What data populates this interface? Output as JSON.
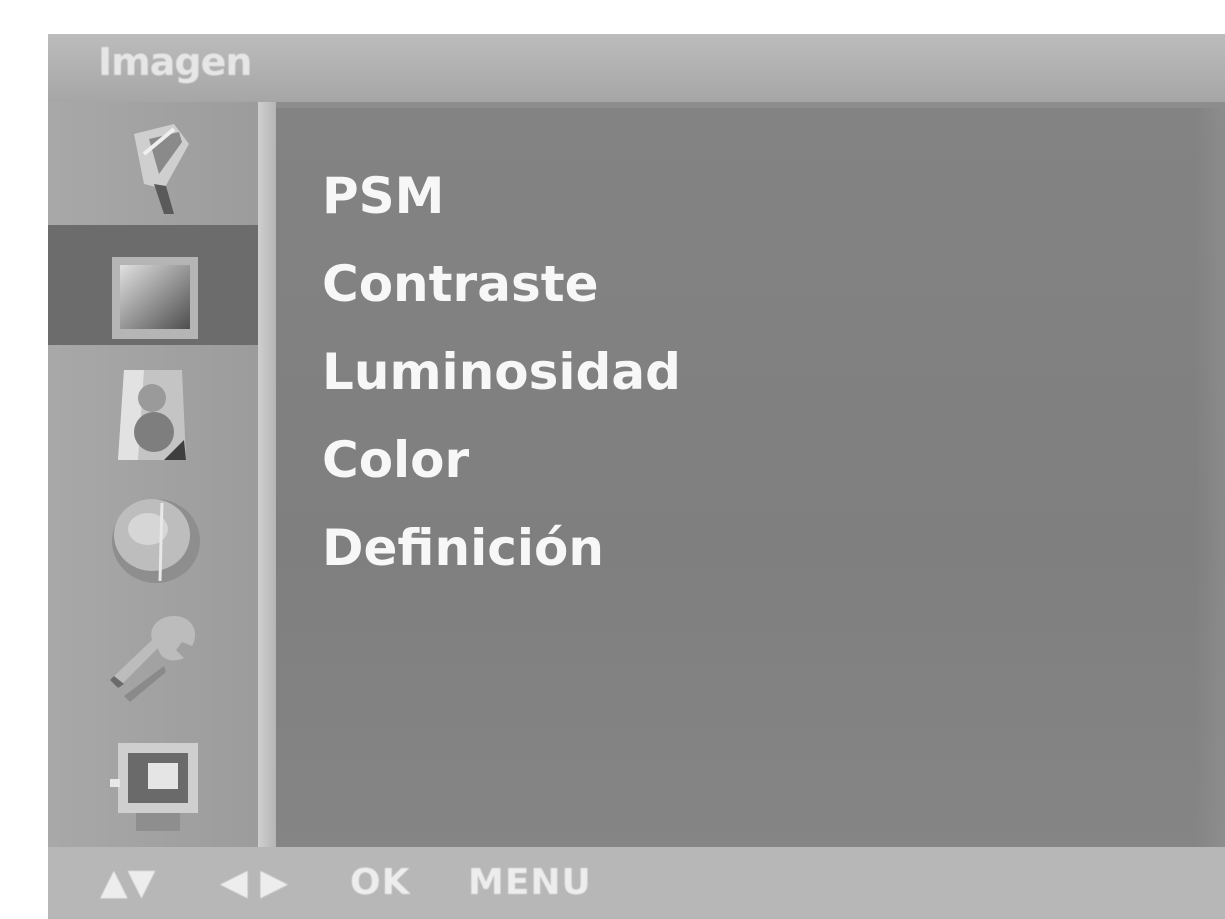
{
  "title": "Imagen",
  "sidebar": {
    "items": [
      {
        "icon": "satellite-dish-icon"
      },
      {
        "icon": "picture-icon",
        "selected": true
      },
      {
        "icon": "speaker-icon"
      },
      {
        "icon": "clock-icon"
      },
      {
        "icon": "wrench-icon"
      },
      {
        "icon": "monitor-icon"
      }
    ]
  },
  "menu": {
    "items": [
      {
        "label": "PSM"
      },
      {
        "label": "Contraste"
      },
      {
        "label": "Luminosidad"
      },
      {
        "label": "Color"
      },
      {
        "label": "Definición"
      }
    ]
  },
  "footer": {
    "updown": "▲▼",
    "leftright": "◀ ▶",
    "ok": "OK",
    "menu": "MENU"
  }
}
